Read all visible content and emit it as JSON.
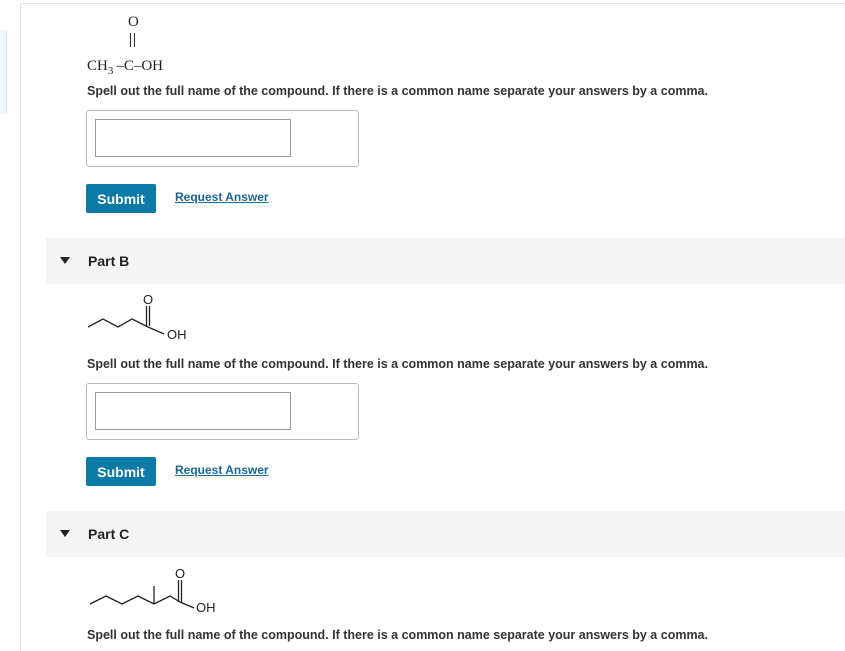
{
  "part_a": {
    "structure": {
      "oxygen": "O",
      "formula_ch": "CH",
      "formula_sub": "3",
      "formula_rest": " –C–OH"
    },
    "instruction": "Spell out the full name of the compound. If there is a common name separate your answers by a comma.",
    "answer_value": "",
    "submit_label": "Submit",
    "request_label": "Request Answer"
  },
  "part_b": {
    "title": "Part B",
    "structure": {
      "oxygen": "O",
      "hydroxyl": "OH"
    },
    "instruction": "Spell out the full name of the compound. If there is a common name separate your answers by a comma.",
    "answer_value": "",
    "submit_label": "Submit",
    "request_label": "Request Answer"
  },
  "part_c": {
    "title": "Part C",
    "structure": {
      "oxygen": "O",
      "hydroxyl": "OH"
    },
    "instruction": "Spell out the full name of the compound. If there is a common name separate your answers by a comma."
  },
  "colors": {
    "submit_bg": "#0b7aa6",
    "link": "#1a6796",
    "part_header_bg": "#f5f5f5"
  },
  "icons": {
    "collapse_caret": "caret-down-icon"
  }
}
